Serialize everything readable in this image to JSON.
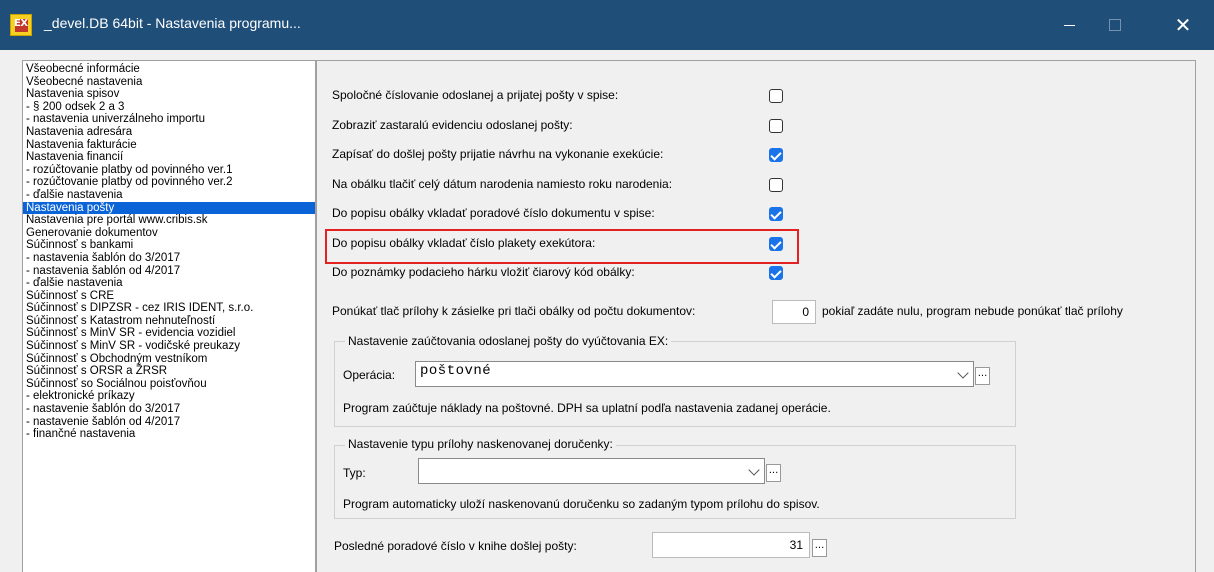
{
  "window": {
    "title": "_devel.DB 64bit - Nastavenia programu...",
    "app_icon_label": "EX",
    "close_glyph": "✕"
  },
  "tree": {
    "items": [
      "Všeobecné informácie",
      "Všeobecné nastavenia",
      "Nastavenia spisov",
      "  - § 200 odsek 2 a 3",
      "  - nastavenia univerzálneho importu",
      "Nastavenia adresára",
      "Nastavenia fakturácie",
      "Nastavenia financií",
      "  - rozúčtovanie platby od povinného ver.1",
      "  - rozúčtovanie platby od povinného ver.2",
      "  - ďalšie nastavenia",
      "Nastavenia pošty",
      "Nastavenia pre portál www.cribis.sk",
      "Generovanie dokumentov",
      "Súčinnosť s bankami",
      "  - nastavenia šablón do 3/2017",
      "  - nastavenia šablón od 4/2017",
      "  - ďalšie nastavenia",
      "Súčinnosť s CRE",
      "Súčinnosť s DIPZSR - cez IRIS IDENT, s.r.o.",
      "Súčinnosť s Katastrom nehnuteľností",
      "Súčinnosť s MinV SR - evidencia vozidiel",
      "Súčinnosť s MinV SR - vodičské preukazy",
      "Súčinnosť s Obchodným vestníkom",
      "Súčinnosť s ORSR a ŽRSR",
      "Súčinnosť so Sociálnou poisťovňou",
      "  - elektronické príkazy",
      "   - nastavenie šablón do 3/2017",
      "   - nastavenie šablón od 4/2017",
      "  - finančné nastavenia"
    ],
    "selected": "Nastavenia pošty"
  },
  "options": [
    {
      "label": "Spoločné číslovanie odoslanej a prijatej pošty v spise:",
      "checked": false
    },
    {
      "label": "Zobraziť zastaralú evidenciu odoslanej pošty:",
      "checked": false
    },
    {
      "label": "Zapísať do došlej pošty prijatie návrhu na vykonanie exekúcie:",
      "checked": true
    },
    {
      "label": "Na obálku tlačiť celý dátum narodenia namiesto roku narodenia:",
      "checked": false
    },
    {
      "label": "Do popisu obálky vkladať poradové číslo dokumentu v spise:",
      "checked": true
    },
    {
      "label": "Do popisu obálky vkladať číslo plakety exekútora:",
      "checked": true
    },
    {
      "label": "Do poznámky podacieho hárku vložiť čiarový kód obálky:",
      "checked": true
    }
  ],
  "attachments_offer": {
    "label": "Ponúkať tlač prílohy k zásielke pri tlači obálky od počtu dokumentov:",
    "value": "0",
    "note": "pokiaľ zadáte nulu, program nebude ponúkať tlač prílohy"
  },
  "postage_group": {
    "title": "Nastavenie zaúčtovania odoslanej pošty do vyúčtovania EX:",
    "operation_label": "Operácia:",
    "operation_value": "poštovné",
    "hint": "Program zaúčtuje náklady na poštovné. DPH sa uplatní podľa nastavenia zadanej operácie."
  },
  "receipt_group": {
    "title": "Nastavenie typu prílohy naskenovanej doručenky:",
    "type_label": "Typ:",
    "type_value": "",
    "hint": "Program automaticky uloží naskenovanú doručenku so zadaným typom prílohu do spisov."
  },
  "last_number": {
    "label": "Posledné poradové číslo v knihe došlej pošty:",
    "value": "31"
  },
  "browse_label": "...",
  "colors": {
    "titlebar": "#1f4e79",
    "selection": "#0a64d8",
    "checkbox_checked": "#1a73e8",
    "highlight_border": "#e32121"
  }
}
